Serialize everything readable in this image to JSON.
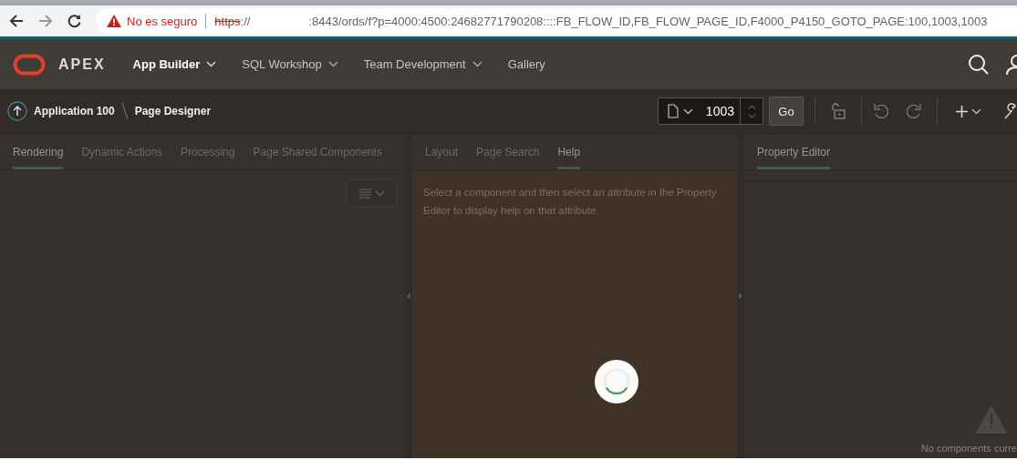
{
  "browser": {
    "security": "No es seguro",
    "url_scheme": "https",
    "url_sep": "://",
    "url_rest": ":8443/ords/f?p=4000:4500:24682771790208::::FB_FLOW_ID,FB_FLOW_PAGE_ID,F4000_P4150_GOTO_PAGE:100,1003,1003"
  },
  "header": {
    "logo": "APEX",
    "nav": [
      {
        "label": "App Builder",
        "selected": true,
        "has_menu": true
      },
      {
        "label": "SQL Workshop",
        "selected": false,
        "has_menu": true
      },
      {
        "label": "Team Development",
        "selected": false,
        "has_menu": true
      },
      {
        "label": "Gallery",
        "selected": false,
        "has_menu": false
      }
    ]
  },
  "toolbar": {
    "breadcrumb": [
      "Application 100",
      "Page Designer"
    ],
    "page_number": "1003",
    "go": "Go"
  },
  "left_panel": {
    "tabs": [
      {
        "label": "Rendering",
        "selected": true
      },
      {
        "label": "Dynamic Actions",
        "selected": false
      },
      {
        "label": "Processing",
        "selected": false
      },
      {
        "label": "Page Shared Components",
        "selected": false
      }
    ]
  },
  "middle_panel": {
    "tabs": [
      {
        "label": "Layout",
        "selected": false
      },
      {
        "label": "Page Search",
        "selected": false
      },
      {
        "label": "Help",
        "selected": true
      }
    ],
    "help_text": "Select a component and then select an attribute in the Property Editor to display help on that attribute."
  },
  "right_panel": {
    "tabs": [
      {
        "label": "Property Editor",
        "selected": true
      }
    ],
    "empty_message": "No components curre"
  },
  "loading": true
}
